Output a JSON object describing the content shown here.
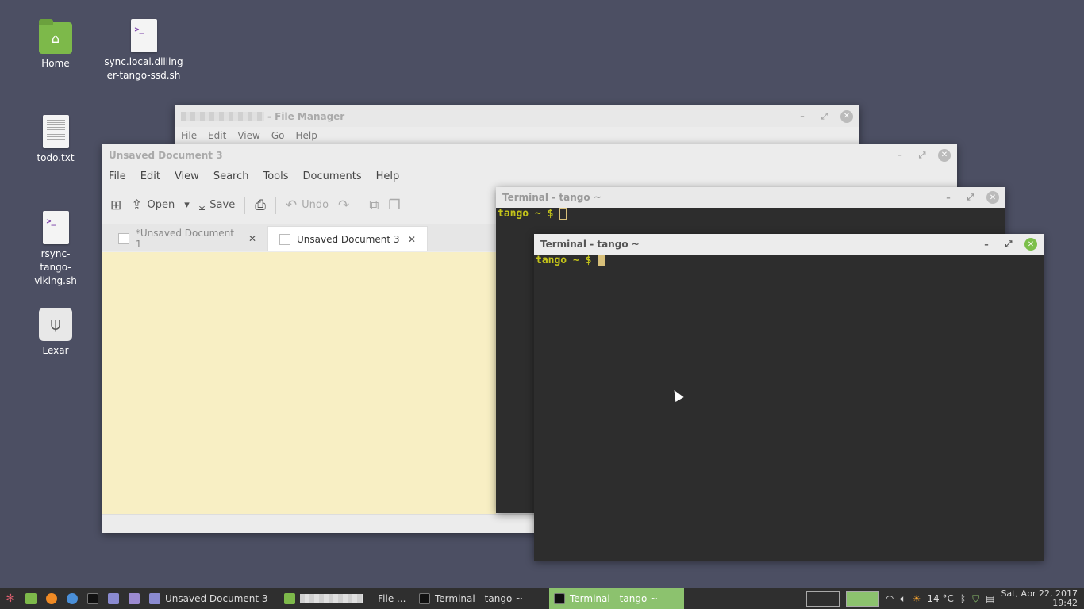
{
  "desktop": {
    "icons": [
      {
        "label": "Home",
        "icon": "home-folder-icon"
      },
      {
        "label": "sync.local.dillinger-tango-ssd.sh",
        "icon": "script-file-icon"
      },
      {
        "label": "todo.txt",
        "icon": "text-file-icon"
      },
      {
        "label": "rsync-tango-viking.sh",
        "icon": "script-file-icon"
      },
      {
        "label": "Lexar",
        "icon": "usb-drive-icon"
      }
    ]
  },
  "file_manager": {
    "title": "- File Manager",
    "menu": [
      "File",
      "Edit",
      "View",
      "Go",
      "Help"
    ]
  },
  "editor": {
    "title": "Unsaved Document 3",
    "menu": [
      "File",
      "Edit",
      "View",
      "Search",
      "Tools",
      "Documents",
      "Help"
    ],
    "toolbar": {
      "open": "Open",
      "save": "Save",
      "undo": "Undo"
    },
    "tabs": [
      "*Unsaved Document 1",
      "Unsaved Document 3"
    ]
  },
  "terminal_back": {
    "title": "Terminal - tango ~",
    "host": "tango",
    "path": "~",
    "prompt": "$"
  },
  "terminal_front": {
    "title": "Terminal - tango ~",
    "host": "tango",
    "path": "~",
    "prompt": "$"
  },
  "taskbar": {
    "tasks": [
      {
        "label": "Unsaved Document 3"
      },
      {
        "label": "- File ..."
      },
      {
        "label": "Terminal - tango ~"
      },
      {
        "label": "Terminal - tango ~"
      }
    ],
    "temperature": "14 °C",
    "date": "Sat, Apr 22, 2017",
    "time": "19:42"
  },
  "colors": {
    "accent": "#8cc26e",
    "desktop": "#4c4f63",
    "prompt": "#c4c419",
    "editor_bg": "#f8efc4"
  }
}
